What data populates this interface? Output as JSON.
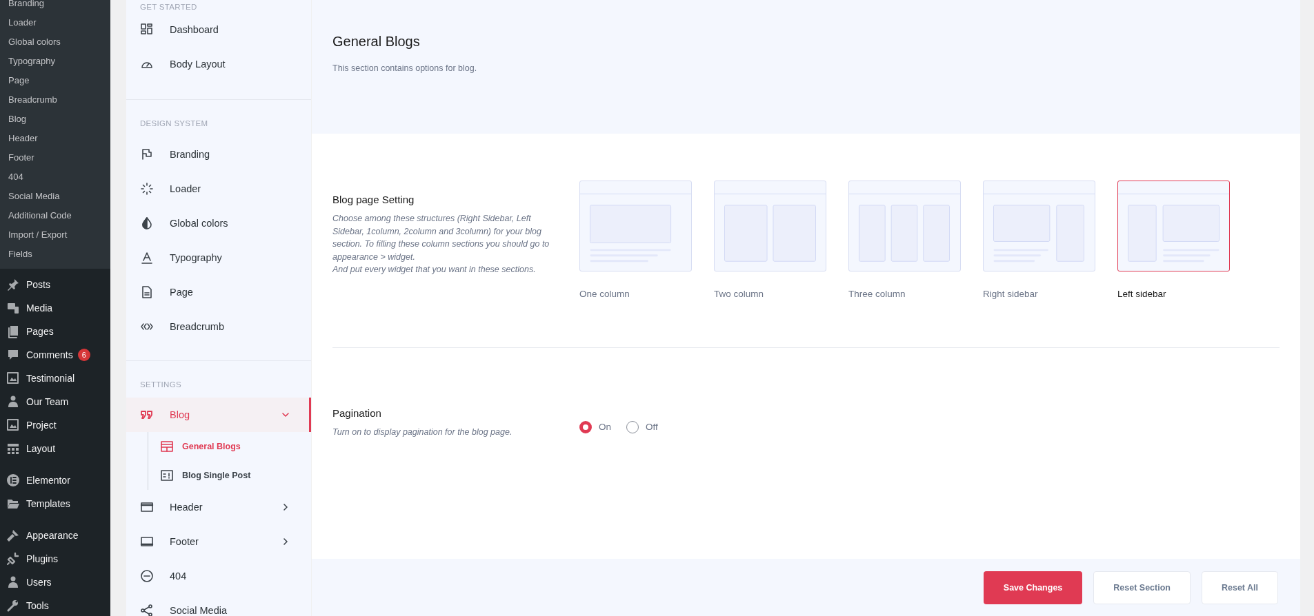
{
  "wp_menu": {
    "submenu": [
      "Branding",
      "Loader",
      "Global colors",
      "Typography",
      "Page",
      "Breadcrumb",
      "Blog",
      "Header",
      "Footer",
      "404",
      "Social Media",
      "Additional Code",
      "Import / Export",
      "Fields"
    ],
    "groups": [
      [
        {
          "label": "Posts"
        },
        {
          "label": "Media"
        },
        {
          "label": "Pages"
        },
        {
          "label": "Comments",
          "badge": "6"
        },
        {
          "label": "Testimonial"
        },
        {
          "label": "Our Team"
        },
        {
          "label": "Project"
        },
        {
          "label": "Layout"
        }
      ],
      [
        {
          "label": "Elementor"
        },
        {
          "label": "Templates"
        }
      ],
      [
        {
          "label": "Appearance"
        },
        {
          "label": "Plugins"
        },
        {
          "label": "Users"
        },
        {
          "label": "Tools"
        }
      ]
    ]
  },
  "options_sidebar": {
    "sections": [
      {
        "heading": "GET STARTED",
        "items": [
          {
            "label": "Dashboard",
            "selected": false
          },
          {
            "label": "Body Layout",
            "selected": false
          }
        ]
      },
      {
        "heading": "DESIGN SYSTEM",
        "items": [
          {
            "label": "Branding",
            "selected": false
          },
          {
            "label": "Loader",
            "selected": false
          },
          {
            "label": "Global colors",
            "selected": false
          },
          {
            "label": "Typography",
            "selected": false
          },
          {
            "label": "Page",
            "selected": false
          },
          {
            "label": "Breadcrumb",
            "selected": false
          }
        ]
      },
      {
        "heading": "SETTINGS",
        "items": [
          {
            "label": "Blog",
            "selected": true,
            "expanded": true,
            "children": [
              {
                "label": "General Blogs",
                "selected": true
              },
              {
                "label": "Blog Single Post",
                "selected": false
              }
            ]
          },
          {
            "label": "Header",
            "selected": false,
            "expanded": false
          },
          {
            "label": "Footer",
            "selected": false,
            "expanded": false
          },
          {
            "label": "404",
            "selected": false
          },
          {
            "label": "Social Media",
            "selected": false
          }
        ]
      }
    ]
  },
  "page_header": {
    "title": "General Blogs",
    "description": "This section contains options for blog."
  },
  "settings": [
    {
      "kind": "layout",
      "title": "Blog page Setting",
      "description": "Choose among these structures (Right Sidebar, Left Sidebar, 1column, 2column and 3column) for your blog section. To filling these column sections you should go to appearance > widget.\nAnd put every widget that you want in these sections.",
      "options": [
        {
          "label": "One column",
          "selected": false
        },
        {
          "label": "Two column",
          "selected": false
        },
        {
          "label": "Three column",
          "selected": false
        },
        {
          "label": "Right sidebar",
          "selected": false
        },
        {
          "label": "Left sidebar",
          "selected": true
        }
      ]
    },
    {
      "kind": "radio",
      "title": "Pagination",
      "description": "Turn on to display pagination for the blog page.",
      "options": [
        {
          "label": "On",
          "selected": true
        },
        {
          "label": "Off",
          "selected": false
        }
      ]
    }
  ],
  "buttons": [
    {
      "label": "Save Changes",
      "kind": "primary"
    },
    {
      "label": "Reset Section",
      "kind": "secondary"
    },
    {
      "label": "Reset All",
      "kind": "secondary"
    }
  ]
}
